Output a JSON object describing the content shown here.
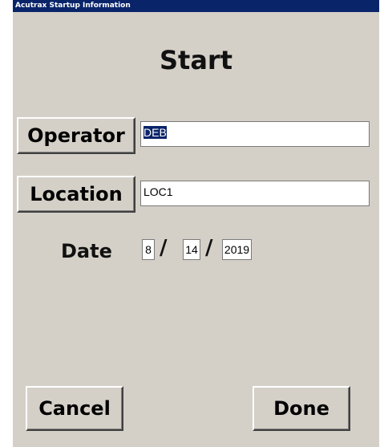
{
  "window": {
    "title": "Acutrax Startup Information"
  },
  "heading": "Start",
  "operator": {
    "button_label": "Operator",
    "value": "DEB"
  },
  "location": {
    "button_label": "Location",
    "value": "LOC1"
  },
  "date": {
    "label": "Date",
    "month": "8",
    "day": "14",
    "year": "2019",
    "separator": "/"
  },
  "actions": {
    "cancel_label": "Cancel",
    "done_label": "Done"
  },
  "colors": {
    "titlebar": "#0a246a",
    "dialog_background": "#d4d0c8",
    "selection": "#0a246a"
  }
}
